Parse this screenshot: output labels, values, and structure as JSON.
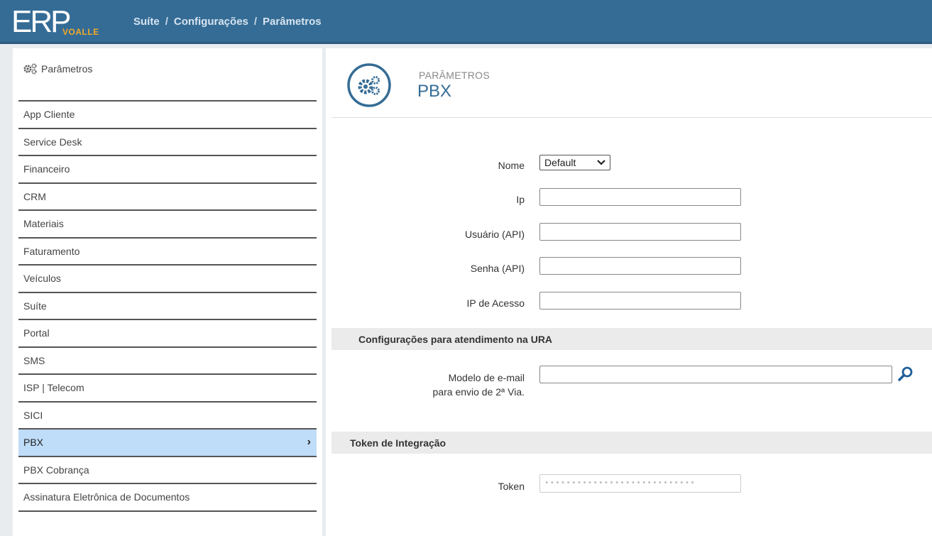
{
  "app": {
    "logo_main": "ERP",
    "logo_sub": "VOALLE",
    "breadcrumb": [
      "Suíte",
      "Configurações",
      "Parâmetros"
    ],
    "breadcrumb_separator": "/"
  },
  "sidebar": {
    "title": "Parâmetros",
    "title_icon": "gears-icon",
    "items": [
      {
        "label": "App Cliente"
      },
      {
        "label": "Service Desk"
      },
      {
        "label": "Financeiro"
      },
      {
        "label": "CRM"
      },
      {
        "label": "Materiais"
      },
      {
        "label": "Faturamento"
      },
      {
        "label": "Veículos"
      },
      {
        "label": "Suíte"
      },
      {
        "label": "Portal"
      },
      {
        "label": "SMS"
      },
      {
        "label": "ISP | Telecom"
      },
      {
        "label": "SICI"
      },
      {
        "label": "PBX",
        "active": true
      },
      {
        "label": "PBX Cobrança"
      },
      {
        "label": "Assinatura Eletrônica de Documentos"
      }
    ],
    "active_chevron": "›"
  },
  "page": {
    "kicker": "PARÂMETROS",
    "title": "PBX",
    "icon": "gears-circle-icon"
  },
  "form": {
    "nome": {
      "label": "Nome",
      "value": "Default"
    },
    "ip": {
      "label": "Ip",
      "value": ""
    },
    "usuario": {
      "label": "Usuário (API)",
      "value": ""
    },
    "senha": {
      "label": "Senha (API)",
      "value": ""
    },
    "ip_acesso": {
      "label": "IP de Acesso",
      "value": ""
    }
  },
  "ura_section": {
    "title": "Configurações para atendimento na URA",
    "email_label_line1": "Modelo de e-mail",
    "email_label_line2": "para envio de 2ª Via.",
    "email_value": "",
    "search_icon": "search-icon"
  },
  "token_section": {
    "title": "Token de Integração",
    "token_label": "Token",
    "token_value": "••••••••••••••••••••••••••••"
  },
  "colors": {
    "topbar": "#356c95",
    "accent_orange": "#f0a92b",
    "active_item": "#bfdcf8",
    "section_bar": "#ebebeb",
    "title_blue": "#356c95"
  }
}
